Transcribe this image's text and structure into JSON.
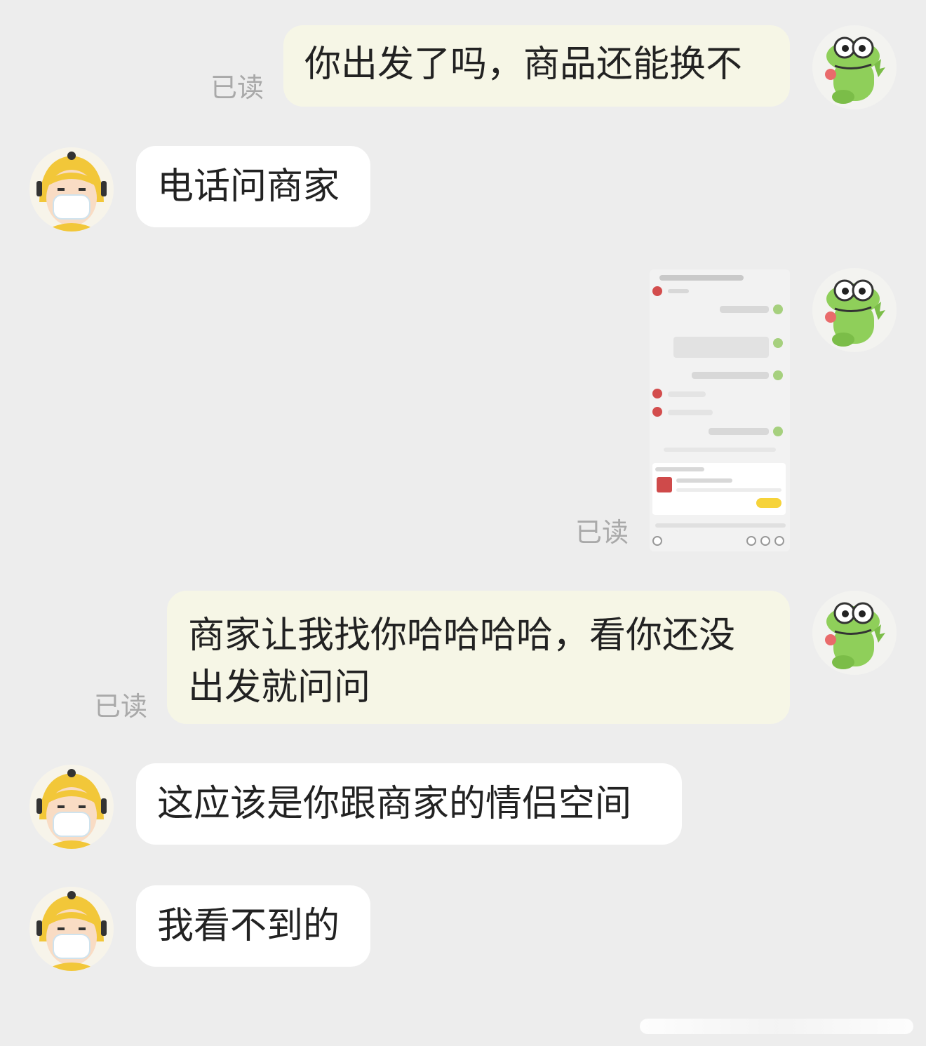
{
  "messages": [
    {
      "text": "你出发了吗，商品还能换不",
      "read": "已读"
    },
    {
      "text": "电话问商家"
    },
    {
      "read": "已读"
    },
    {
      "text": "商家让我找你哈哈哈哈，看你还没出发就问问",
      "read": "已读"
    },
    {
      "text": "这应该是你跟商家的情侣空间"
    },
    {
      "text": "我看不到的"
    }
  ],
  "colors": {
    "background": "#ededed",
    "outgoing_bubble": "#f6f6e6",
    "incoming_bubble": "#ffffff",
    "read_label": "#a9a9a9"
  },
  "icons": {
    "self_avatar": "green-crocodile-avatar-icon",
    "other_avatar": "courier-with-mask-avatar-icon"
  }
}
